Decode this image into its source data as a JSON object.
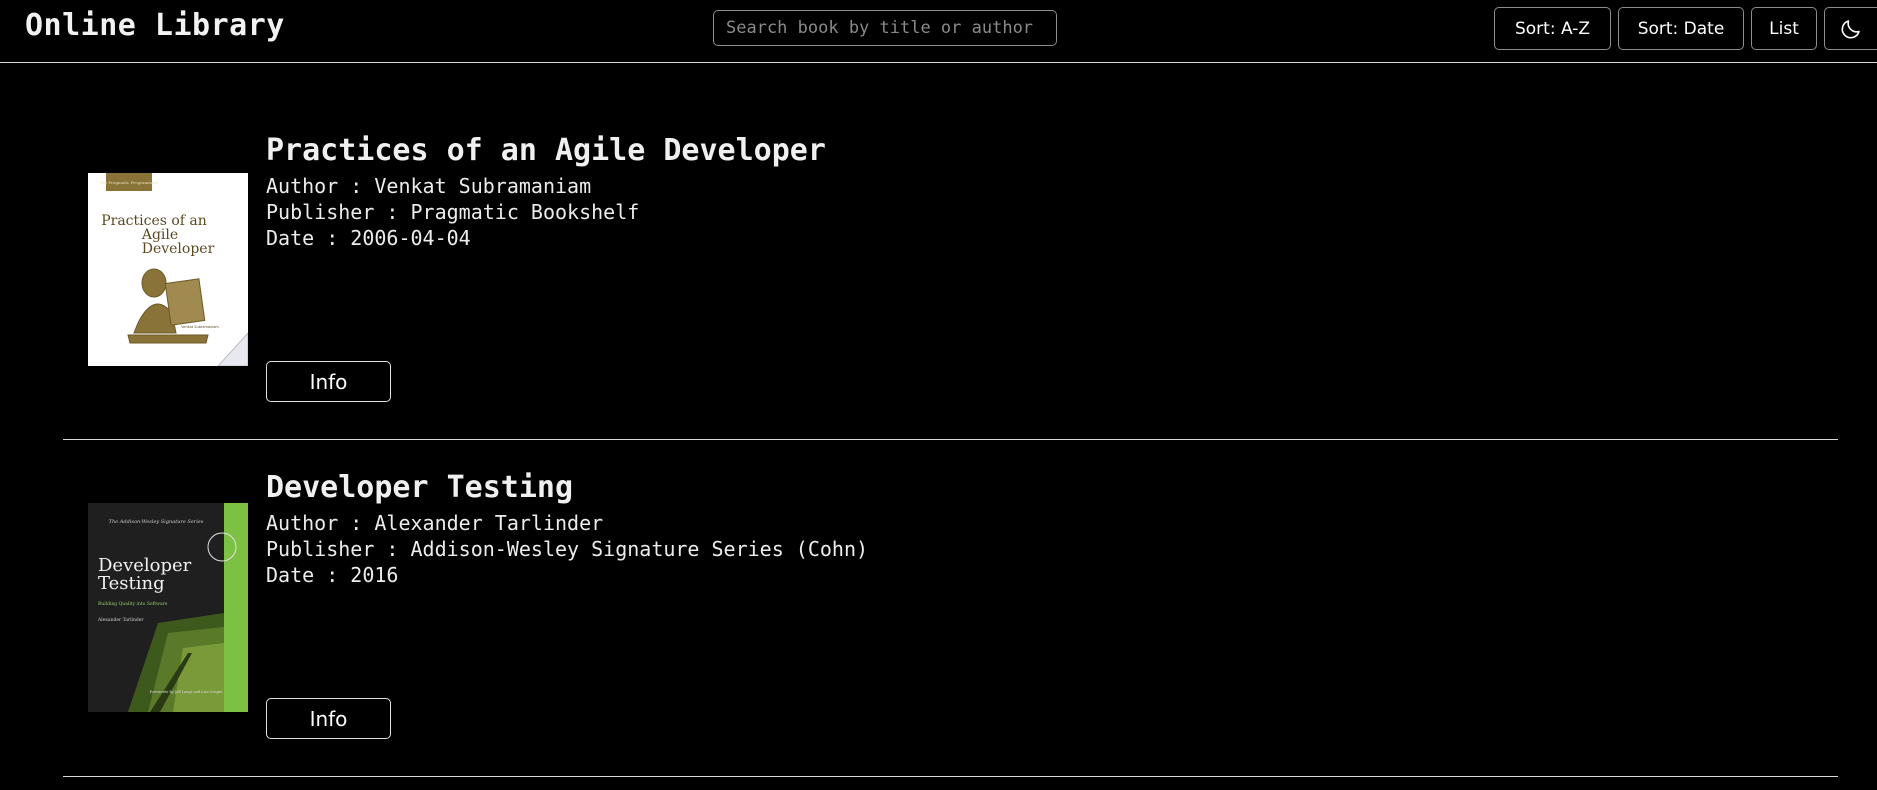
{
  "header": {
    "title": "Online Library",
    "search_placeholder": "Search book by title or author",
    "sort_az_label": "Sort: A-Z",
    "sort_date_label": "Sort: Date",
    "list_label": "List",
    "theme_icon": "moon-icon"
  },
  "books": [
    {
      "title": "Practices of an Agile Developer",
      "author": "Author : Venkat Subramaniam",
      "publisher": "Publisher : Pragmatic Bookshelf",
      "date": "Date : 2006-04-04",
      "info_label": "Info",
      "cover": {
        "series": "The Pragmatic Programmers",
        "title_line1": "Practices of an",
        "title_line2": "Agile",
        "title_line3": "Developer",
        "byline": "Venkat Subramaniam",
        "colors": {
          "background": "#ffffff",
          "ink": "#7a6530",
          "band": "#8a7338"
        }
      }
    },
    {
      "title": "Developer Testing",
      "author": "Author : Alexander Tarlinder",
      "publisher": "Publisher : Addison-Wesley Signature Series (Cohn)",
      "date": "Date : 2016",
      "info_label": "Info",
      "cover": {
        "series": "The Addison-Wesley Signature Series",
        "title_line1": "Developer",
        "title_line2": "Testing",
        "subtitle": "Building Quality into Software",
        "byline": "Alexander Tarlinder",
        "foreword": "Forewords by Jeff Langr and Lisa Crispin",
        "colors": {
          "background": "#1c1c1c",
          "stripe": "#7cc143",
          "field": "#5a7a2a"
        }
      }
    }
  ]
}
